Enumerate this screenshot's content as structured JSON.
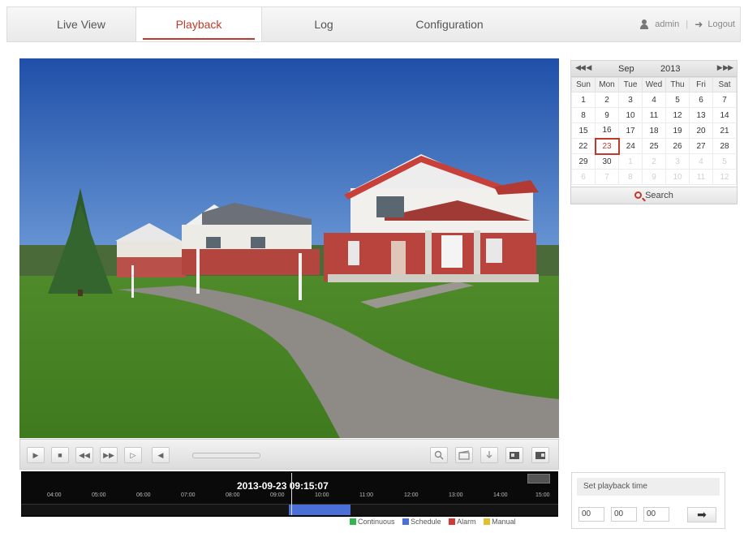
{
  "nav": {
    "tabs": [
      "Live View",
      "Playback",
      "Log",
      "Configuration"
    ],
    "active": "Playback",
    "user": "admin",
    "logout": "Logout"
  },
  "controls": {
    "buttons_left": [
      "play-icon",
      "stop-icon",
      "slow-forward-icon",
      "fast-forward-icon",
      "frame-forward-icon",
      "volume-icon"
    ],
    "buttons_right": [
      "capture-icon",
      "clip-icon",
      "download-icon",
      "zoom-icon",
      "record-icon"
    ],
    "play_glyph": "▶",
    "stop_glyph": "■",
    "slow_glyph": "◀◀",
    "fast_glyph": "▶▶",
    "frame_glyph": "▷",
    "volume_glyph": "◀"
  },
  "timeline": {
    "current_time": "2013-09-23 09:15:07",
    "ticks": [
      "04:00",
      "05:00",
      "06:00",
      "07:00",
      "08:00",
      "09:00",
      "10:00",
      "11:00",
      "12:00",
      "13:00",
      "14:00",
      "15:00"
    ],
    "legend": [
      {
        "label": "Continuous",
        "color": "#2fb84a"
      },
      {
        "label": "Schedule",
        "color": "#4a6fd6"
      },
      {
        "label": "Alarm",
        "color": "#d23a3a"
      },
      {
        "label": "Manual",
        "color": "#e0c030"
      }
    ]
  },
  "calendar": {
    "prev_glyph": "◀◀ ◀",
    "next_glyph": "▶ ▶▶",
    "month": "Sep",
    "year": "2013",
    "weekdays": [
      "Sun",
      "Mon",
      "Tue",
      "Wed",
      "Thu",
      "Fri",
      "Sat"
    ],
    "weeks": [
      [
        "1",
        "2",
        "3",
        "4",
        "5",
        "6",
        "7"
      ],
      [
        "8",
        "9",
        "10",
        "11",
        "12",
        "13",
        "14"
      ],
      [
        "15",
        "16",
        "17",
        "18",
        "19",
        "20",
        "21"
      ],
      [
        "22",
        "23",
        "24",
        "25",
        "26",
        "27",
        "28"
      ],
      [
        "29",
        "30",
        "1",
        "2",
        "3",
        "4",
        "5"
      ],
      [
        "6",
        "7",
        "8",
        "9",
        "10",
        "11",
        "12"
      ]
    ],
    "selected_day": "23",
    "search_label": "Search"
  },
  "set_time": {
    "title": "Set playback time",
    "hour": "00",
    "minute": "00",
    "second": "00",
    "go_glyph": "➡"
  }
}
